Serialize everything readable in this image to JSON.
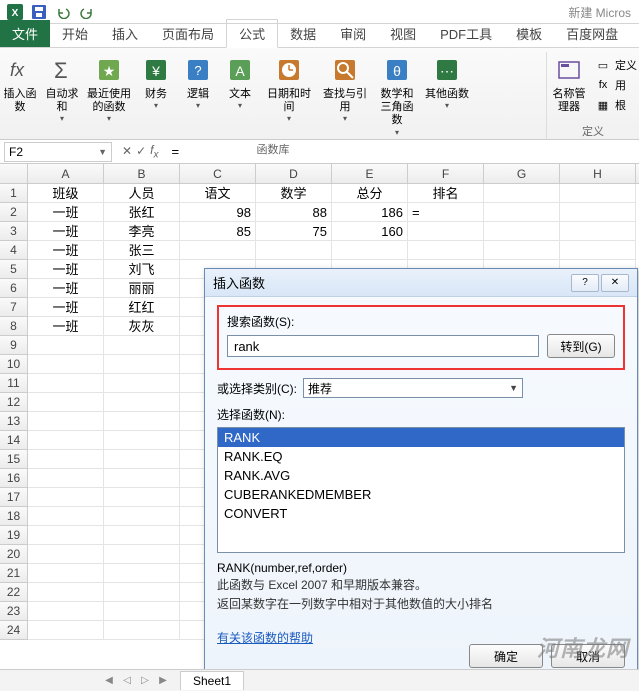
{
  "qat": {
    "title_partial": "新建 Micros"
  },
  "tabs": {
    "file": "文件",
    "items": [
      "开始",
      "插入",
      "页面布局",
      "公式",
      "数据",
      "审阅",
      "视图",
      "PDF工具",
      "模板",
      "百度网盘"
    ],
    "active": "公式"
  },
  "ribbon": {
    "insert_fn": "插入函数",
    "autosum": "自动求和",
    "recent": "最近使用的函数",
    "financial": "财务",
    "logical": "逻辑",
    "text": "文本",
    "datetime": "日期和时间",
    "lookup": "查找与引用",
    "math": "数学和三角函数",
    "more": "其他函数",
    "group_label": "函数库",
    "name_mgr": "名称管理器",
    "define": "定义",
    "use": "用",
    "create": "根"
  },
  "formula_bar": {
    "name_box": "F2",
    "value": "="
  },
  "columns": [
    "A",
    "B",
    "C",
    "D",
    "E",
    "F",
    "G",
    "H"
  ],
  "row_nums": [
    "1",
    "2",
    "3",
    "4",
    "5",
    "6",
    "7",
    "8",
    "9",
    "10",
    "11",
    "12",
    "13",
    "14",
    "15",
    "16",
    "17",
    "18",
    "19",
    "20",
    "21",
    "22",
    "23",
    "24"
  ],
  "grid": {
    "headers": [
      "班级",
      "人员",
      "语文",
      "数学",
      "总分",
      "排名"
    ],
    "rows": [
      {
        "a": "一班",
        "b": "张红",
        "c": "98",
        "d": "88",
        "e": "186",
        "f": "="
      },
      {
        "a": "一班",
        "b": "李亮",
        "c": "85",
        "d": "75",
        "e": "160",
        "f": ""
      },
      {
        "a": "一班",
        "b": "张三",
        "c": "",
        "d": "",
        "e": "",
        "f": ""
      },
      {
        "a": "一班",
        "b": "刘飞",
        "c": "",
        "d": "",
        "e": "",
        "f": ""
      },
      {
        "a": "一班",
        "b": "丽丽",
        "c": "",
        "d": "",
        "e": "",
        "f": ""
      },
      {
        "a": "一班",
        "b": "红红",
        "c": "",
        "d": "",
        "e": "",
        "f": ""
      },
      {
        "a": "一班",
        "b": "灰灰",
        "c": "",
        "d": "",
        "e": "",
        "f": ""
      }
    ]
  },
  "dialog": {
    "title": "插入函数",
    "search_label": "搜索函数(S):",
    "search_value": "rank",
    "go_btn": "转到(G)",
    "cat_label": "或选择类别(C):",
    "cat_value": "推荐",
    "list_label": "选择函数(N):",
    "functions": [
      "RANK",
      "RANK.EQ",
      "RANK.AVG",
      "CUBERANKEDMEMBER",
      "CONVERT"
    ],
    "selected": "RANK",
    "signature": "RANK(number,ref,order)",
    "desc1": "此函数与 Excel 2007 和早期版本兼容。",
    "desc2": "返回某数字在一列数字中相对于其他数值的大小排名",
    "help": "有关该函数的帮助",
    "ok": "确定",
    "cancel": "取消"
  },
  "sheet": {
    "name": "Sheet1"
  },
  "watermark": "河南龙网"
}
